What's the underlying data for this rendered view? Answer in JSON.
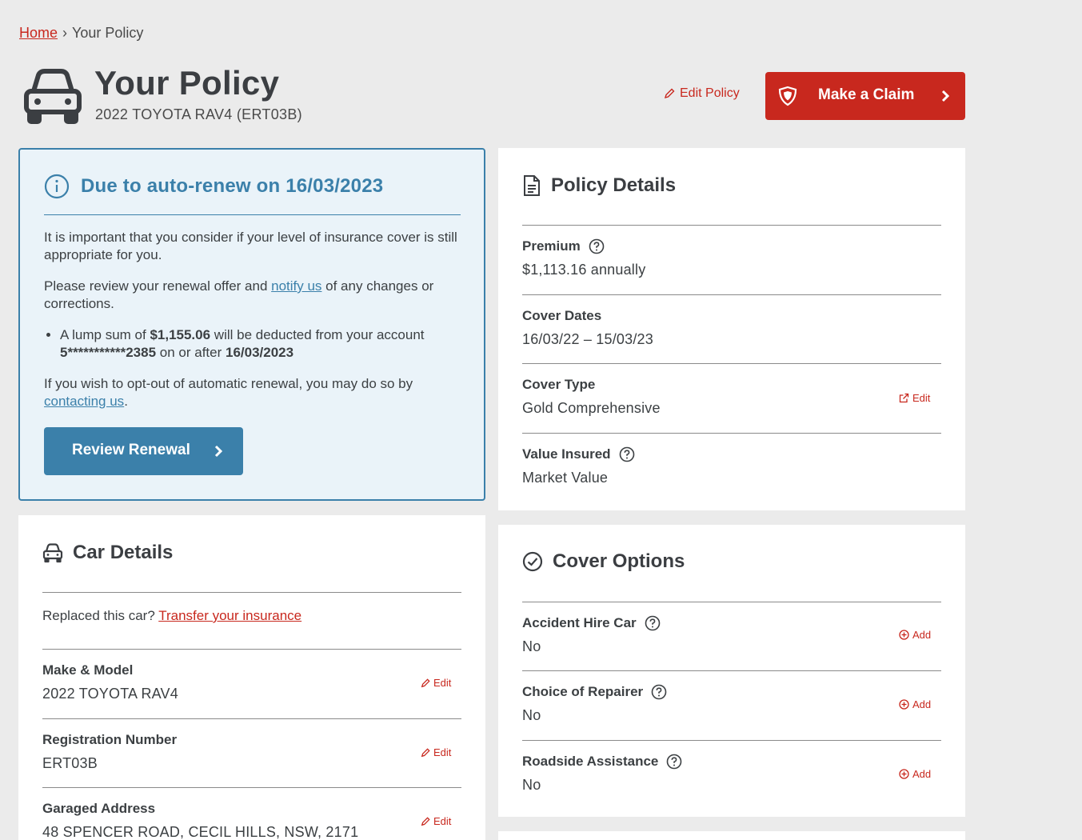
{
  "breadcrumb": {
    "home": "Home",
    "separator": "›",
    "current": "Your Policy"
  },
  "header": {
    "title": "Your Policy",
    "vehicle": "2022 TOYOTA RAV4 (ERT03B)",
    "edit_policy": "Edit Policy",
    "claim_button": "Make a Claim"
  },
  "renewal": {
    "title": "Due to auto-renew on 16/03/2023",
    "para1": "It is important that you consider if your level of insurance cover is still appropriate for you.",
    "para2_before": "Please review your renewal offer and ",
    "para2_link": "notify us",
    "para2_after": " of any changes or corrections.",
    "bullet_1": "A lump sum of ",
    "bullet_amount": "$1,155.06",
    "bullet_2": " will be deducted from your account ",
    "bullet_account": "5***********2385",
    "bullet_3": " on or after ",
    "bullet_date": "16/03/2023",
    "para3_before": "If you wish to opt-out of automatic renewal, you may do so by ",
    "para3_link": "contacting us",
    "para3_after": ".",
    "button": "Review Renewal"
  },
  "policy_details": {
    "title": "Policy Details",
    "premium_label": "Premium",
    "premium_value": "$1,113.16 annually",
    "dates_label": "Cover Dates",
    "dates_value": "16/03/22 – 15/03/23",
    "type_label": "Cover Type",
    "type_value": "Gold Comprehensive",
    "type_action": "Edit",
    "insured_label": "Value Insured",
    "insured_value": "Market Value"
  },
  "car_details": {
    "title": "Car Details",
    "replaced_text": "Replaced this car? ",
    "transfer_link": "Transfer your insurance",
    "make_label": "Make & Model",
    "make_value": "2022 TOYOTA RAV4",
    "rego_label": "Registration Number",
    "rego_value": "ERT03B",
    "address_label": "Garaged Address",
    "address_value": "48 SPENCER ROAD, CECIL HILLS, NSW, 2171",
    "edit": "Edit"
  },
  "cover_options": {
    "title": "Cover Options",
    "hire_label": "Accident Hire Car",
    "hire_value": "No",
    "repairer_label": "Choice of Repairer",
    "repairer_value": "No",
    "roadside_label": "Roadside Assistance",
    "roadside_value": "No",
    "add": "Add"
  },
  "colors": {
    "brand_red": "#c8281e",
    "info_blue": "#3b80aa",
    "info_bg": "#eaf3f9",
    "page_bg": "#ebebeb"
  },
  "icons": [
    "car-icon",
    "pencil-icon",
    "shield-icon",
    "chevron-right-icon",
    "info-icon",
    "document-icon",
    "help-icon",
    "external-link-icon",
    "check-circle-icon",
    "plus-circle-icon"
  ]
}
